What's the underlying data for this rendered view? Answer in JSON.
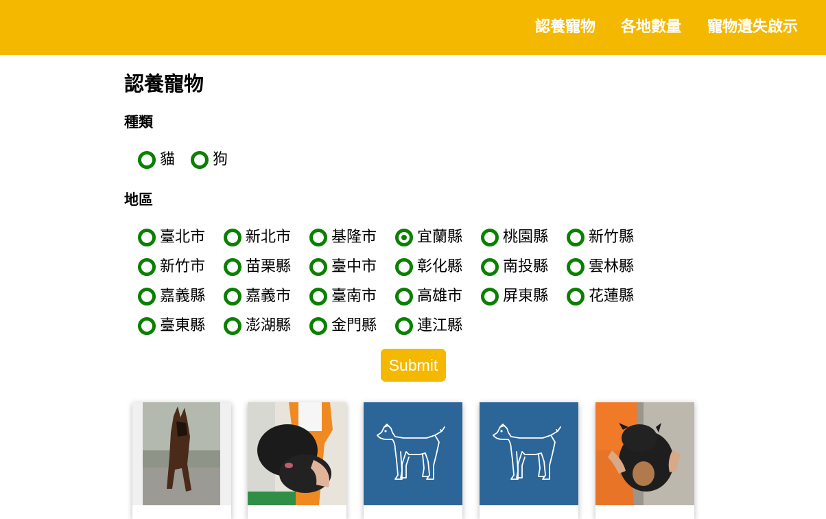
{
  "nav": {
    "items": [
      "認養寵物",
      "各地數量",
      "寵物遺失啟示"
    ]
  },
  "page": {
    "title": "認養寵物"
  },
  "type_section": {
    "label": "種類",
    "options": [
      "貓",
      "狗"
    ],
    "selected": null
  },
  "region_section": {
    "label": "地區",
    "options": [
      "臺北市",
      "新北市",
      "基隆市",
      "宜蘭縣",
      "桃園縣",
      "新竹縣",
      "新竹市",
      "苗栗縣",
      "臺中市",
      "彰化縣",
      "南投縣",
      "雲林縣",
      "嘉義縣",
      "嘉義市",
      "臺南市",
      "高雄市",
      "屏東縣",
      "花蓮縣",
      "臺東縣",
      "澎湖縣",
      "金門縣",
      "連江縣"
    ],
    "selected": "宜蘭縣"
  },
  "submit": {
    "label": "Submit"
  },
  "pets": {
    "cards": [
      {
        "image": "photo-german-shepherd"
      },
      {
        "image": "photo-black-poodle"
      },
      {
        "image": "dog-placeholder-icon"
      },
      {
        "image": "dog-placeholder-icon"
      },
      {
        "image": "photo-black-puppy"
      }
    ]
  },
  "colors": {
    "nav_background": "#f5b800",
    "accent": "#f5b800",
    "radio": "#0a8000",
    "placeholder_background": "#2c6699"
  }
}
